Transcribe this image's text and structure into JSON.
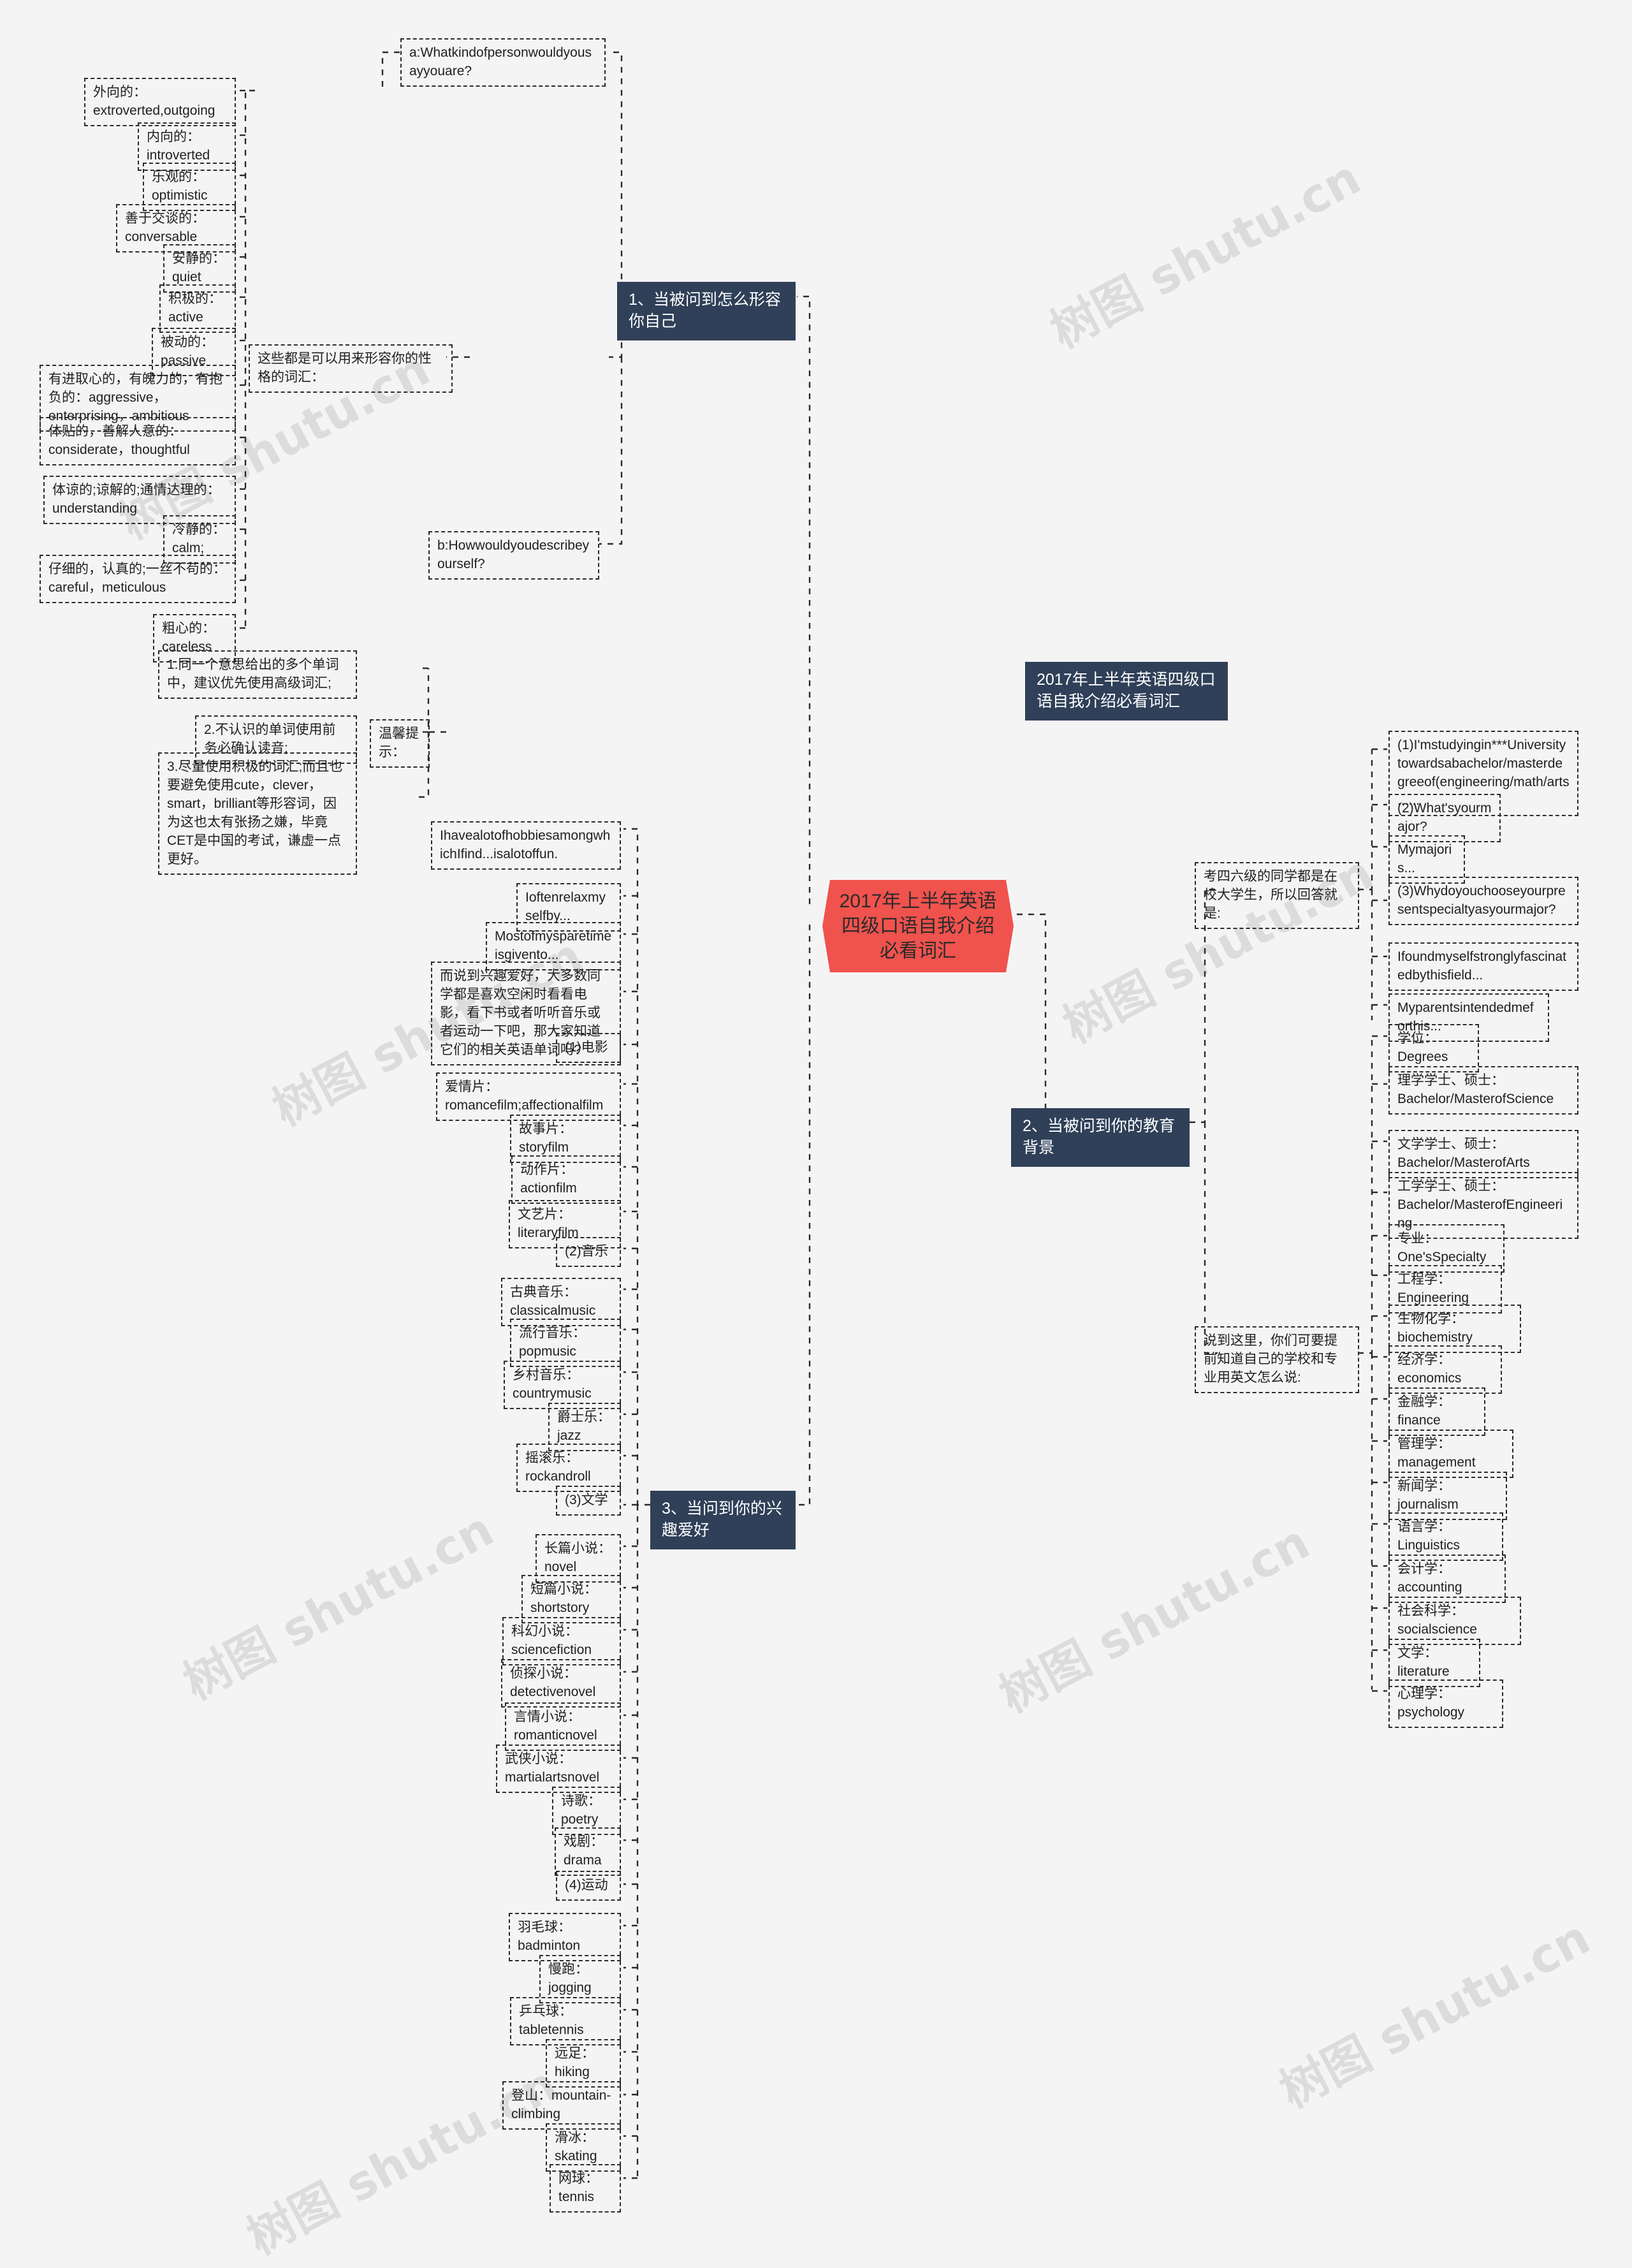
{
  "meta": {
    "watermark_text": "树图 shutu.cn",
    "background_color": "#f4f4f4",
    "accent_color": "#f0524d",
    "branch_color": "#2f4058"
  },
  "center": {
    "title": "2017年上半年英语四级口语自我介绍必看词汇"
  },
  "top_right_header": {
    "title": "2017年上半年英语四级口语自我介绍必看词汇"
  },
  "branches": [
    {
      "id": "b1",
      "label": "1、当被问到怎么形容你自己"
    },
    {
      "id": "b2",
      "label": "2、当被问到你的教育背景"
    },
    {
      "id": "b3",
      "label": "3、当问到你的兴趣爱好"
    }
  ],
  "branch1": {
    "question_a": "a:Whatkindofpersonwouldyousayyouare?",
    "question_b": "b:Howwouldyoudescribeyourself?",
    "intro": "这些都是可以用来形容你的性格的词汇：",
    "adjectives": [
      "外向的：extroverted,outgoing",
      "内向的：introverted",
      "乐观的：optimistic",
      "善于交谈的：conversable",
      "安静的：quiet",
      "积极的：active",
      "被动的：passive",
      "有进取心的，有魄力的，有抱负的：aggressive，enterprising，ambitious",
      "体贴的，善解人意的：considerate，thoughtful",
      "体谅的;谅解的;通情达理的：understanding",
      "冷静的：calm;",
      "仔细的，认真的;一丝不苟的：careful，meticulous",
      "粗心的：careless"
    ],
    "tips_label": "温馨提示：",
    "tips": [
      "1.同一个意思给出的多个单词中，建议优先使用高级词汇;",
      "2.不认识的单词使用前务必确认读音;",
      "3.尽量使用积极的词汇;而且也要避免使用cute，clever，smart，brilliant等形容词，因为这也太有张扬之嫌，毕竟CET是中国的考试，谦虚一点更好。"
    ]
  },
  "branch2": {
    "note_top": "考四六级的同学都是在校大学生，所以回答就是:",
    "note_bottom": "说到这里，你们可要提前知道自己的学校和专业用英文怎么说:",
    "answers": [
      "(1)I'mstudyingin***Universitytowardsabachelor/masterdegreeof(engineering/math/arts......",
      "(2)What'syourmajor?",
      "Mymajoris...",
      "(3)Whydoyouchooseyourpresentspecialtyasyourmajor?",
      "Ifoundmyselfstronglyfascinatedbythisfield...",
      "Myparentsintendedmeforthis..."
    ],
    "vocabulary": [
      "学位：Degrees",
      "理学学士、硕士：Bachelor/MasterofScience",
      "文学学士、硕士：Bachelor/MasterofArts",
      "工学学士、硕士：Bachelor/MasterofEngineering",
      "专业：One'sSpecialty",
      "工程学：Engineering",
      "生物化学：biochemistry",
      "经济学：economics",
      "金融学：finance",
      "管理学：management",
      "新闻学：journalism",
      "语言学：Linguistics",
      "会计学：accounting",
      "社会科学：socialscience",
      "文学：literature",
      "心理学：psychology"
    ]
  },
  "branch3": {
    "openers": [
      "IhavealotofhobbiesamongwhichIfind...isalotoffun.",
      "Ioftenrelaxmyselfby...",
      "Mostofmysparetimeisgivento..."
    ],
    "note": "而说到兴趣爱好，大多数同学都是喜欢空闲时看看电影，看下书或者听听音乐或者运动一下吧，那大家知道它们的相关英语单词吗?",
    "groups": [
      {
        "label": "(1)电影",
        "items": [
          "爱情片：romancefilm;affectionalfilm",
          "故事片：storyfilm",
          "动作片：actionfilm",
          "文艺片：literaryfilm"
        ]
      },
      {
        "label": "(2)音乐",
        "items": [
          "古典音乐：classicalmusic",
          "流行音乐：popmusic",
          "乡村音乐：countrymusic",
          "爵士乐：jazz",
          "摇滚乐：rockandroll"
        ]
      },
      {
        "label": "(3)文学",
        "items": [
          "长篇小说：novel",
          "短篇小说：shortstory",
          "科幻小说：sciencefiction",
          "侦探小说：detectivenovel",
          "言情小说：romanticnovel",
          "武侠小说：martialartsnovel",
          "诗歌：poetry",
          "戏剧：drama"
        ]
      },
      {
        "label": "(4)运动",
        "items": [
          "羽毛球：badminton",
          "慢跑：jogging",
          "乒乓球：tabletennis",
          "远足：hiking",
          "登山：mountain-climbing",
          "滑冰：skating",
          "网球：tennis"
        ]
      }
    ]
  }
}
